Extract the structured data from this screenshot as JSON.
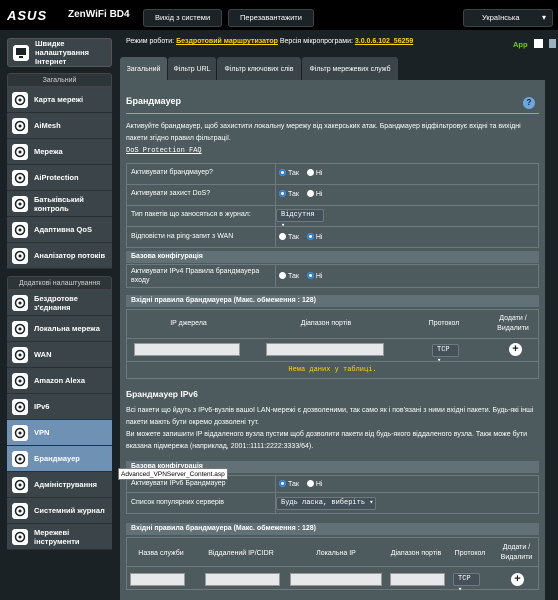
{
  "header": {
    "brand": "ASUS",
    "model": "ZenWiFi BD4",
    "logout_label": "Вихід з системи",
    "reboot_label": "Перезавантажити",
    "language": "Українська"
  },
  "status": {
    "mode_label": "Режим роботи:",
    "mode_value": "Бездротовий маршрутизатор",
    "firmware_label": "Версія мікропрограми:",
    "firmware_value": "3.0.0.6.102_56259",
    "app_label": "App"
  },
  "sidebar": {
    "quick": "Швидке налаштування Інтернет",
    "general_header": "Загальний",
    "general_items": [
      {
        "label": "Карта мережі",
        "icon": "network-map-icon"
      },
      {
        "label": "AiMesh",
        "icon": "aimesh-icon"
      },
      {
        "label": "Мережа",
        "icon": "network-icon"
      },
      {
        "label": "AiProtection",
        "icon": "aiprotection-icon"
      },
      {
        "label": "Батьківський контроль",
        "icon": "parental-control-icon"
      },
      {
        "label": "Адаптивна QoS",
        "icon": "qos-icon"
      },
      {
        "label": "Аналізатор потоків",
        "icon": "traffic-analyzer-icon"
      }
    ],
    "advanced_header": "Додаткові налаштування",
    "advanced_items": [
      {
        "label": "Бездротове з'єднання",
        "icon": "wireless-icon"
      },
      {
        "label": "Локальна мережа",
        "icon": "lan-icon"
      },
      {
        "label": "WAN",
        "icon": "wan-icon"
      },
      {
        "label": "Amazon Alexa",
        "icon": "alexa-icon"
      },
      {
        "label": "IPv6",
        "icon": "ipv6-icon"
      },
      {
        "label": "VPN",
        "icon": "vpn-icon"
      },
      {
        "label": "Брандмауер",
        "icon": "firewall-icon"
      },
      {
        "label": "Адміністрування",
        "icon": "administration-icon"
      },
      {
        "label": "Системний журнал",
        "icon": "system-log-icon"
      },
      {
        "label": "Мережеві інструменти",
        "icon": "network-tools-icon"
      }
    ]
  },
  "tabs": [
    "Загальний",
    "Фільтр URL",
    "Фільтр ключових слів",
    "Фільтр мережевих служб"
  ],
  "firewall": {
    "title": "Брандмауер",
    "description": "Активуйте брандмауер, щоб захистити локальну мережу від хакерських атак. Брандмауер відфільтровує вхідні та вихідні пакети згідно правил фільтрації.",
    "faq_link": "DoS Protection FAQ",
    "rows": [
      {
        "label": "Активувати брандмауер?",
        "yes": "Так",
        "no": "Ні",
        "value": "Так"
      },
      {
        "label": "Активувати захист DoS?",
        "yes": "Так",
        "no": "Ні",
        "value": "Так"
      },
      {
        "label": "Тип пакетів що заносяться в журнал:",
        "select": "Відсутня"
      },
      {
        "label": "Відповісти на ping-запит з WAN",
        "yes": "Так",
        "no": "Ні",
        "value": "Ні"
      }
    ],
    "basic_config": "Базова конфігурація",
    "ipv4_inbound_label": "Активувати IPv4 Правила брандмауера входу",
    "ipv4_inbound_value": "Ні",
    "inbound_rules_title": "Вхідні правила брандмауера (Макс. обмеження : 128)",
    "table_headers": [
      "IP джерела",
      "Діапазон портів",
      "Протокол",
      "Додати / Видалити"
    ],
    "protocol": "TCP",
    "no_data": "Нема даних у таблиці."
  },
  "ipv6": {
    "title": "Брандмауер IPv6",
    "description1": "Всі пакети що йдуть з IPv6-вузлів вашої LAN-мережі є дозволеними, так само як і пов'язані з ними вхідні пакети. Будь-які інші пакети мають бути окремо дозволені тут.",
    "description2": "Ви можете запишити IP віддаленого вузла пустим щоб дозволити пакети від будь-якого віддаленого вузла. Такж може бути вказана підмережа (наприклад, 2001::1111:2222:3333/64).",
    "basic_config": "Базова конфігурація",
    "enable_label": "Активувати IPv6 Брандмауер",
    "enable_yes": "Так",
    "enable_no": "Ні",
    "enable_value": "Так",
    "popular_label": "Список популярних серверів",
    "popular_select": "Будь ласка, виберіть",
    "rules_title": "Вхідні правила брандмауера (Макс. обмеження : 128)",
    "table_headers": [
      "Назва служби",
      "Віддалений IP/CIDR",
      "Локальна IP",
      "Діапазон портів",
      "Протокол",
      "Додати / Видалити"
    ],
    "protocol": "TCP"
  },
  "tooltip": "Advanced_VPNServer_Content.asp"
}
